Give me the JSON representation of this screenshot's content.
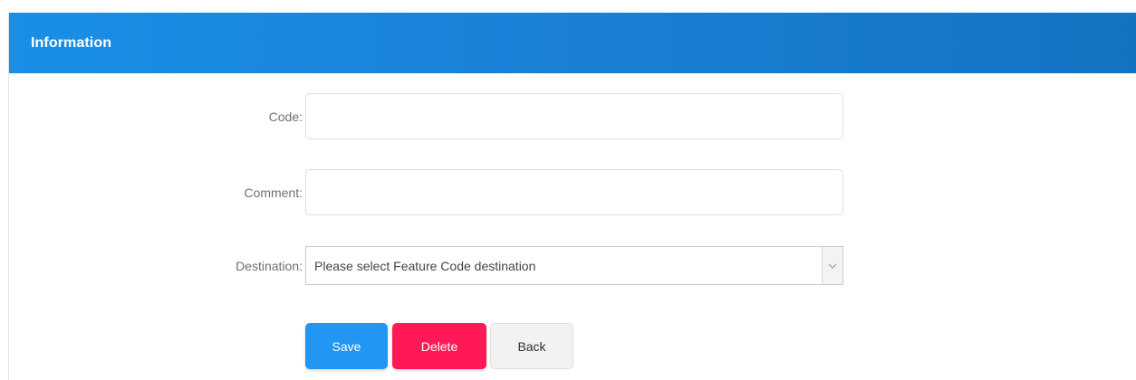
{
  "panel": {
    "title": "Information",
    "header_color": "#1a84dc"
  },
  "form": {
    "code": {
      "label": "Code:",
      "value": "",
      "placeholder": ""
    },
    "comment": {
      "label": "Comment:",
      "value": "",
      "placeholder": ""
    },
    "destination": {
      "label": "Destination:",
      "selected": "Please select Feature Code destination",
      "icon": "chevron-down-icon"
    }
  },
  "buttons": {
    "save": {
      "label": "Save",
      "color": "#2196f3"
    },
    "delete": {
      "label": "Delete",
      "color": "#ff1a57"
    },
    "back": {
      "label": "Back",
      "color": "#f2f2f2"
    }
  }
}
